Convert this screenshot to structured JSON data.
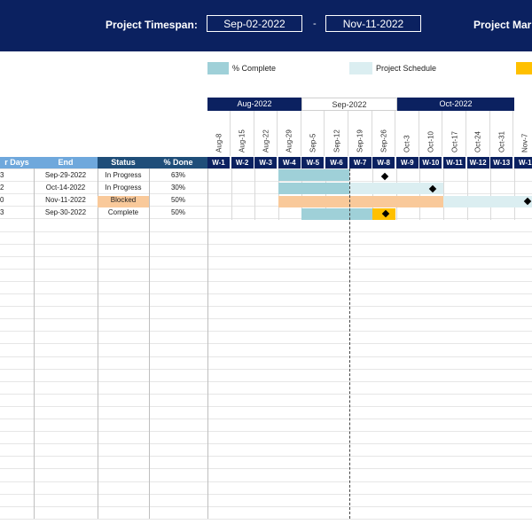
{
  "header": {
    "timespan_label": "Project Timespan:",
    "start_date": "Sep-02-2022",
    "separator": "-",
    "end_date": "Nov-11-2022",
    "manager_label": "Project Mar"
  },
  "legend": {
    "complete_label": "% Complete",
    "schedule_label": "Project Schedule",
    "complete_color": "#9fd0d8",
    "schedule_color": "#dbeef1",
    "milestone_color": "#ffc000"
  },
  "months": [
    "Aug-2022",
    "Sep-2022",
    "Oct-2022"
  ],
  "dates": [
    "Aug-8",
    "Aug-15",
    "Aug-22",
    "Aug-29",
    "Sep-5",
    "Sep-12",
    "Sep-19",
    "Sep-26",
    "Oct-3",
    "Oct-10",
    "Oct-17",
    "Oct-24",
    "Oct-31",
    "Nov-7"
  ],
  "weeks": [
    "W-1",
    "W-2",
    "W-3",
    "W-4",
    "W-5",
    "W-6",
    "W-7",
    "W-8",
    "W-9",
    "W-10",
    "W-11",
    "W-12",
    "W-13",
    "W-1"
  ],
  "columns": {
    "days": "r Days",
    "end": "End",
    "status": "Status",
    "done": "% Done"
  },
  "tasks": [
    {
      "days": "3",
      "end": "Sep-29-2022",
      "status": "In Progress",
      "done": "63%"
    },
    {
      "days": "2",
      "end": "Oct-14-2022",
      "status": "In Progress",
      "done": "30%"
    },
    {
      "days": "0",
      "end": "Nov-11-2022",
      "status": "Blocked",
      "done": "50%"
    },
    {
      "days": "3",
      "end": "Sep-30-2022",
      "status": "Complete",
      "done": "50%"
    }
  ]
}
